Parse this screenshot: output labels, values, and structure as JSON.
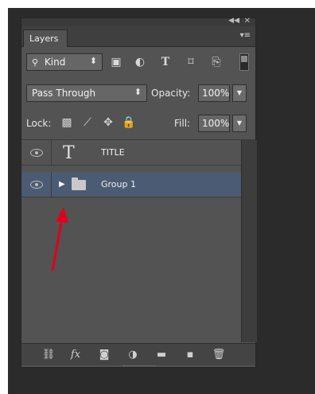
{
  "panel": {
    "tab_label": "Layers",
    "collapse_icon": "double-chevron-icon",
    "close_icon": "close-icon",
    "menu_icon": "panel-menu-icon"
  },
  "filter": {
    "kind_label": "Kind",
    "icons": [
      "pixel-filter-icon",
      "adjustment-filter-icon",
      "type-filter-icon",
      "shape-filter-icon",
      "smart-object-filter-icon"
    ]
  },
  "blend": {
    "mode": "Pass Through",
    "opacity_label": "Opacity:",
    "opacity_value": "100%"
  },
  "lock": {
    "label": "Lock:",
    "fill_label": "Fill:",
    "fill_value": "100%",
    "icons": [
      "lock-transparent-icon",
      "lock-image-icon",
      "lock-position-icon",
      "lock-all-icon"
    ]
  },
  "layers": [
    {
      "name": "TITLE",
      "kind": "type",
      "visible": true,
      "selected": false
    },
    {
      "name": "Group 1",
      "kind": "group",
      "visible": true,
      "selected": true,
      "expanded": false
    }
  ],
  "bottom_icons": [
    "link-icon",
    "fx-icon",
    "mask-icon",
    "adjustment-icon",
    "new-group-icon",
    "new-layer-icon",
    "trash-icon"
  ],
  "colors": {
    "panel_bg": "#535353",
    "selected_row": "#4b5b73",
    "annotation_arrow": "#e0001b"
  }
}
